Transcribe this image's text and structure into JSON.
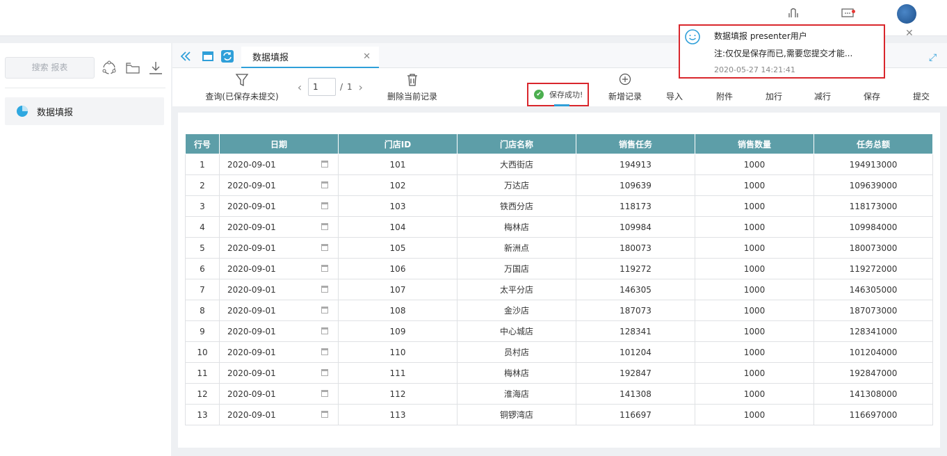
{
  "sidebar": {
    "search_label": "搜索 报表",
    "items": [
      {
        "label": "数据填报"
      }
    ]
  },
  "tabs": [
    {
      "label": "数据填报"
    }
  ],
  "toolbar": {
    "query_label": "查询(已保存未提交)",
    "page_current": "1",
    "page_sep": "/",
    "page_total": "1",
    "delete_label": "删除当前记录",
    "save_success": "保存成功!",
    "add_label": "新增记录",
    "import_label": "导入",
    "attach_label": "附件",
    "add_row_label": "加行",
    "del_row_label": "减行",
    "save_label": "保存",
    "submit_label": "提交"
  },
  "notification": {
    "title": "数据填报 presenter用户",
    "body": "注:仅仅是保存而已,需要您提交才能...",
    "time": "2020-05-27 14:21:41"
  },
  "table": {
    "columns": [
      "行号",
      "日期",
      "门店ID",
      "门店名称",
      "销售任务",
      "销售数量",
      "任务总额"
    ],
    "rows": [
      [
        "1",
        "2020-09-01",
        "101",
        "大西街店",
        "194913",
        "1000",
        "194913000"
      ],
      [
        "2",
        "2020-09-01",
        "102",
        "万达店",
        "109639",
        "1000",
        "109639000"
      ],
      [
        "3",
        "2020-09-01",
        "103",
        "铁西分店",
        "118173",
        "1000",
        "118173000"
      ],
      [
        "4",
        "2020-09-01",
        "104",
        "梅林店",
        "109984",
        "1000",
        "109984000"
      ],
      [
        "5",
        "2020-09-01",
        "105",
        "新洲点",
        "180073",
        "1000",
        "180073000"
      ],
      [
        "6",
        "2020-09-01",
        "106",
        "万国店",
        "119272",
        "1000",
        "119272000"
      ],
      [
        "7",
        "2020-09-01",
        "107",
        "太平分店",
        "146305",
        "1000",
        "146305000"
      ],
      [
        "8",
        "2020-09-01",
        "108",
        "金沙店",
        "187073",
        "1000",
        "187073000"
      ],
      [
        "9",
        "2020-09-01",
        "109",
        "中心城店",
        "128341",
        "1000",
        "128341000"
      ],
      [
        "10",
        "2020-09-01",
        "110",
        "员村店",
        "101204",
        "1000",
        "101204000"
      ],
      [
        "11",
        "2020-09-01",
        "111",
        "梅林店",
        "192847",
        "1000",
        "192847000"
      ],
      [
        "12",
        "2020-09-01",
        "112",
        "淮海店",
        "141308",
        "1000",
        "141308000"
      ],
      [
        "13",
        "2020-09-01",
        "113",
        "铜锣湾店",
        "116697",
        "1000",
        "116697000"
      ]
    ]
  },
  "colors": {
    "accent": "#2f9fd9",
    "header_bg": "#5d9ea8",
    "highlight_border": "#d9262c",
    "success": "#4caf50"
  }
}
